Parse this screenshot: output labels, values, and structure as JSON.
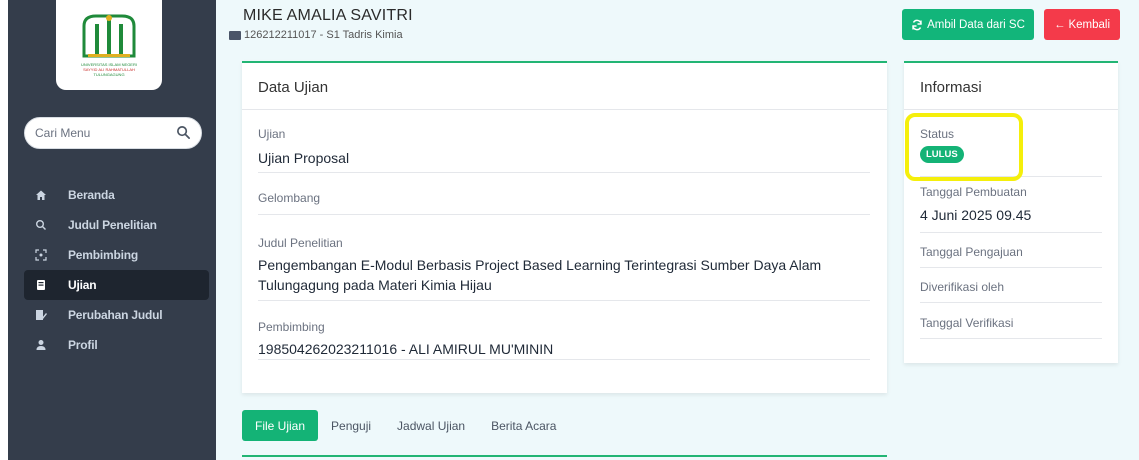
{
  "logo": {
    "line1": "UNIVERSITAS ISLAM NEGERI",
    "line2": "SAYYID ALI RAHMATULLAH",
    "line3": "TULUNGAGUNG"
  },
  "search": {
    "placeholder": "Cari Menu"
  },
  "menu": [
    {
      "label": "Beranda",
      "icon": "home-icon",
      "active": false
    },
    {
      "label": "Judul Penelitian",
      "icon": "search-icon",
      "active": false
    },
    {
      "label": "Pembimbing",
      "icon": "scan-icon",
      "active": false
    },
    {
      "label": "Ujian",
      "icon": "book-icon",
      "active": true
    },
    {
      "label": "Perubahan Judul",
      "icon": "edit-icon",
      "active": false
    },
    {
      "label": "Profil",
      "icon": "user-icon",
      "active": false
    }
  ],
  "student": {
    "name": "MIKE AMALIA SAVITRI",
    "id_line": "126212211017 - S1 Tadris Kimia"
  },
  "buttons": {
    "sync": "Ambil Data dari SC",
    "back": "Kembali"
  },
  "ujian": {
    "title": "Data Ujian",
    "fields": [
      {
        "label": "Ujian",
        "value": "Ujian Proposal"
      },
      {
        "label": "Gelombang",
        "value": ""
      },
      {
        "label": "Judul Penelitian",
        "value": "Pengembangan E-Modul Berbasis Project Based Learning Terintegrasi Sumber Daya Alam Tulungagung pada Materi Kimia Hijau"
      },
      {
        "label": "Pembimbing",
        "value": "198504262023211016 - ALI AMIRUL MU'MININ"
      }
    ]
  },
  "info": {
    "title": "Informasi",
    "status_label": "Status",
    "status_value": "LULUS",
    "tanggal_pembuatan_label": "Tanggal Pembuatan",
    "tanggal_pembuatan_value": "4 Juni 2025 09.45",
    "tanggal_pengajuan_label": "Tanggal Pengajuan",
    "diverifikasi_label": "Diverifikasi oleh",
    "tanggal_verifikasi_label": "Tanggal Verifikasi"
  },
  "tabs": [
    {
      "label": "File Ujian",
      "active": true
    },
    {
      "label": "Penguji",
      "active": false
    },
    {
      "label": "Jadwal Ujian",
      "active": false
    },
    {
      "label": "Berita Acara",
      "active": false
    }
  ],
  "colors": {
    "sidebar": "#343d4b",
    "accent": "#14b376",
    "danger": "#f43a4a",
    "highlight": "#f5ef0b"
  }
}
